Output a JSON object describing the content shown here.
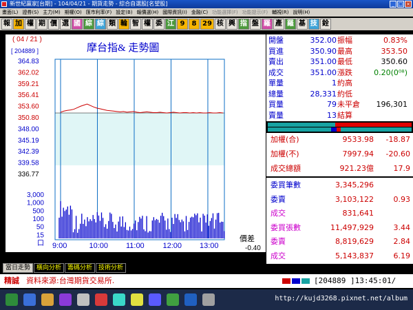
{
  "window": {
    "title": "新世紀贏家[台期] - 104/04/21 - 期貨走勢 - 綜合自選股[名望股]"
  },
  "menu": [
    "畫面(L)",
    "證券(S)",
    "主力(M)",
    "期權(O)",
    "匯市利率(F)",
    "設定(B)",
    "報價選(H)",
    "國際資訊(I)",
    "金融(C)",
    "功能選擇(F)",
    "功能提示(F)",
    "輔視(R)",
    "說明(H)"
  ],
  "toolbar": [
    "報",
    "加",
    "權",
    "期",
    "價",
    "選",
    "國",
    "綜",
    "綜",
    "類",
    "輪",
    "智",
    "權",
    "委",
    "江",
    "9",
    "8",
    "29",
    "核",
    "興",
    "指",
    "盤",
    "羅",
    "產",
    "羅",
    "基",
    "技",
    "銓"
  ],
  "chart": {
    "date": "( 04 / 21 )",
    "volume_box": "[ 204889 ]",
    "title": "摩台指&  走勢圖",
    "diff_label": "價差",
    "diff_value": "-0.40"
  },
  "chart_data": {
    "type": "line",
    "price_ticks": [
      "364.83",
      "362.02",
      "359.21",
      "356.41",
      "353.60",
      "350.80",
      "348.00",
      "345.19",
      "342.39",
      "339.58",
      "336.77"
    ],
    "volume_ticks": [
      "3,000",
      "1,000",
      "500",
      "100",
      "50",
      "15",
      "口"
    ],
    "time_ticks": [
      "9:00",
      "10:00",
      "11:00",
      "12:00",
      "13:00"
    ],
    "ylim": [
      336.77,
      364.83
    ],
    "reference": 350.8,
    "price": [
      351.0,
      351.3,
      351.5,
      351.6,
      351.8,
      352.2,
      352.6,
      352.9,
      353.2,
      352.8,
      352.4,
      352.1,
      351.9,
      351.7,
      351.5,
      351.4,
      351.3,
      351.2,
      351.1,
      351.2,
      351.0,
      351.1,
      351.2,
      351.0,
      350.9,
      351.0,
      351.1,
      351.0,
      350.9,
      350.9,
      351.0,
      350.9,
      350.8,
      350.9,
      351.0,
      350.9,
      350.8,
      350.9,
      350.9,
      350.8,
      350.9,
      350.8,
      350.9,
      350.8,
      350.8,
      350.9,
      350.8,
      350.8,
      350.9,
      350.8
    ]
  },
  "quote": [
    {
      "l1": "開盤",
      "v1": "352.00",
      "l2": "振幅",
      "v2": "0.83%",
      "c2": ""
    },
    {
      "l1": "買進",
      "v1": "350.90",
      "l2": "最高",
      "v2": "353.50",
      "c2": ""
    },
    {
      "l1": "賣出",
      "v1": "351.00",
      "l2": "最低",
      "v2": "350.60",
      "c2": "blk"
    },
    {
      "l1": "成交",
      "v1": "351.00",
      "l2": "漲跌",
      "v2": "0.20(0⁰⁸)",
      "c2": "grn"
    },
    {
      "l1": "單量",
      "v1": "1",
      "l2": "約高",
      "v2": "",
      "c2": ""
    },
    {
      "l1": "總量",
      "v1": "28,331",
      "l2": "約低",
      "v2": "",
      "c2": ""
    },
    {
      "l1": "買量",
      "v1": "79",
      "l2": "未平倉",
      "v2": "196,301",
      "c2": "blk"
    },
    {
      "l1": "賣量",
      "v1": "13",
      "l2": "結算",
      "v2": "",
      "c2": ""
    }
  ],
  "panel1": [
    {
      "l": "加權(合)",
      "v": "9533.98",
      "c": "-18.87"
    },
    {
      "l": "加權(不)",
      "v": "7997.94",
      "c": "-20.60"
    },
    {
      "l": "成交總額",
      "v": "921.23億",
      "c": "17.9"
    }
  ],
  "panel2": [
    {
      "l": "委買筆數",
      "v": "3,345,296",
      "c": "",
      "cls": "blue"
    },
    {
      "l": "委賣",
      "v": "3,103,122",
      "c": "0.93",
      "cls": "blue"
    },
    {
      "l": "成交",
      "v": "831,641",
      "c": "",
      "cls": "mag"
    },
    {
      "l": "委買張數",
      "v": "11,497,929",
      "c": "3.44",
      "cls": "mag"
    },
    {
      "l": "委賣",
      "v": "8,819,629",
      "c": "2.84",
      "cls": "mag"
    },
    {
      "l": "成交",
      "v": "5,143,837",
      "c": "6.19",
      "cls": "mag"
    }
  ],
  "tabs": [
    "當日走勢",
    "橫向分析",
    "籌碼分析",
    "技術分析"
  ],
  "status": {
    "left": "精誠",
    "source": "資料來源:台灣期貨交易所.",
    "code": "[204889 ]13:45:01/"
  },
  "watermark": "http://kujd3268.pixnet.net/album",
  "colors": {
    "price": "#cc0000",
    "volume": "#0000cc",
    "grid": "#0b6cc4",
    "fill": "#e0f6f6"
  }
}
